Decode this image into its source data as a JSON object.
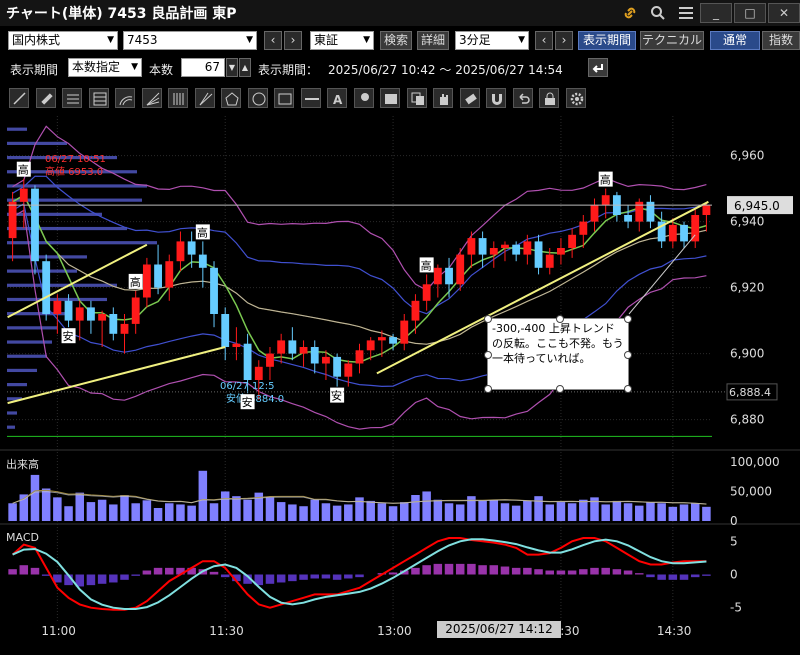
{
  "window": {
    "title": "チャート(単体) 7453 良品計画 東P",
    "buttons": [
      "_",
      "□",
      "✕"
    ]
  },
  "toolbar1": {
    "market_type": "国内株式",
    "symbol": "7453",
    "exchange": "東証",
    "search_label": "検索",
    "detail_label": "詳細",
    "interval": "3分足",
    "display_period_label": "表示期間",
    "technical_label": "テクニカル",
    "normal_label": "通常",
    "index_label": "指数"
  },
  "toolbar2": {
    "period_label": "表示期間",
    "period_mode": "本数指定",
    "count_label": "本数",
    "count_value": "67",
    "period_range_label": "表示期間：",
    "period_range": "2025/06/27 10:42 ～ 2025/06/27 14:54"
  },
  "drawing_tools": [
    "line-tool",
    "ruler-tool",
    "hlines-tool",
    "channel-tool",
    "arc-tool",
    "fan-tool",
    "vlines-tool",
    "speedline-tool",
    "pentagon-tool",
    "circle-tool",
    "rect-tool",
    "hline-tool",
    "text-tool",
    "icon-tool",
    "memo-tool",
    "copy-tool",
    "hand-tool",
    "eraser-tool",
    "magnet-tool",
    "undo-tool",
    "lock-tool",
    "settings-tool"
  ],
  "price_chart": {
    "y_ticks": [
      "6,960",
      "6,940",
      "6,920",
      "6,900",
      "6,880"
    ],
    "current_price_label": "6,945.0",
    "low_line_label": "6,888.4",
    "high_annotation_time": "06/27 10:51",
    "high_annotation_value": "高値 6953.0",
    "low_annotation_time": "06/27 12:5",
    "low_annotation_value": "安値 6884.0",
    "markers_high": [
      "高",
      "高",
      "高",
      "高",
      "高"
    ],
    "markers_low": [
      "安",
      "安",
      "安"
    ],
    "memo_text": "-300,-400 上昇トレンドの反転。ここも不発。もう一本待っていれば。"
  },
  "volume_chart": {
    "label": "出来高",
    "y_ticks": [
      "100,000",
      "50,000",
      "0"
    ]
  },
  "macd_chart": {
    "label": "MACD",
    "y_ticks": [
      "5",
      "0",
      "-5"
    ]
  },
  "time_axis": {
    "labels": [
      "11:00",
      "11:30",
      "13:00",
      "13:30",
      "14:30"
    ],
    "cursor_time": "2025/06/27 14:12"
  },
  "colors": {
    "up_candle": "#ff1a1a",
    "down_candle": "#66ccff",
    "ma_fast": "#7ac850",
    "ma_slow": "#a08a40",
    "bollinger_outer": "#b050b0",
    "bollinger_inner": "#4050d0",
    "trendline": "#f0f080",
    "volume_bar": "#8080ff",
    "macd_line": "#ff0000",
    "signal_line": "#80e0e0"
  },
  "chart_data": {
    "type": "candlestick",
    "price": {
      "ylim": [
        6872,
        6972
      ],
      "candles": [
        [
          6935,
          6949,
          6928,
          6946
        ],
        [
          6946,
          6953,
          6938,
          6950
        ],
        [
          6950,
          6951,
          6924,
          6928
        ],
        [
          6928,
          6930,
          6910,
          6912
        ],
        [
          6912,
          6918,
          6906,
          6916
        ],
        [
          6916,
          6918,
          6908,
          6910
        ],
        [
          6910,
          6916,
          6904,
          6914
        ],
        [
          6914,
          6916,
          6906,
          6910
        ],
        [
          6910,
          6913,
          6902,
          6912
        ],
        [
          6912,
          6914,
          6904,
          6906
        ],
        [
          6906,
          6912,
          6900,
          6909
        ],
        [
          6909,
          6919,
          6906,
          6917
        ],
        [
          6917,
          6929,
          6914,
          6927
        ],
        [
          6927,
          6933,
          6918,
          6920
        ],
        [
          6920,
          6930,
          6916,
          6928
        ],
        [
          6928,
          6937,
          6925,
          6934
        ],
        [
          6934,
          6937,
          6926,
          6930
        ],
        [
          6930,
          6934,
          6920,
          6926
        ],
        [
          6926,
          6928,
          6908,
          6912
        ],
        [
          6912,
          6914,
          6898,
          6902
        ],
        [
          6902,
          6908,
          6898,
          6903
        ],
        [
          6903,
          6906,
          6888,
          6892
        ],
        [
          6892,
          6898,
          6886,
          6896
        ],
        [
          6896,
          6902,
          6892,
          6900
        ],
        [
          6900,
          6906,
          6897,
          6904
        ],
        [
          6904,
          6908,
          6898,
          6900
        ],
        [
          6900,
          6904,
          6896,
          6902
        ],
        [
          6902,
          6904,
          6894,
          6897
        ],
        [
          6897,
          6901,
          6892,
          6899
        ],
        [
          6899,
          6900,
          6890,
          6893
        ],
        [
          6893,
          6898,
          6890,
          6897
        ],
        [
          6897,
          6903,
          6894,
          6901
        ],
        [
          6901,
          6905,
          6898,
          6904
        ],
        [
          6904,
          6907,
          6899,
          6905
        ],
        [
          6905,
          6906,
          6901,
          6903
        ],
        [
          6903,
          6912,
          6901,
          6910
        ],
        [
          6910,
          6918,
          6906,
          6916
        ],
        [
          6916,
          6924,
          6913,
          6921
        ],
        [
          6921,
          6927,
          6917,
          6926
        ],
        [
          6926,
          6929,
          6917,
          6921
        ],
        [
          6921,
          6932,
          6919,
          6930
        ],
        [
          6930,
          6937,
          6926,
          6935
        ],
        [
          6935,
          6937,
          6926,
          6930
        ],
        [
          6930,
          6934,
          6926,
          6932
        ],
        [
          6932,
          6934,
          6928,
          6933
        ],
        [
          6933,
          6934,
          6928,
          6930
        ],
        [
          6930,
          6936,
          6927,
          6934
        ],
        [
          6934,
          6936,
          6924,
          6926
        ],
        [
          6926,
          6932,
          6924,
          6930
        ],
        [
          6930,
          6935,
          6927,
          6932
        ],
        [
          6932,
          6938,
          6929,
          6936
        ],
        [
          6936,
          6942,
          6932,
          6940
        ],
        [
          6940,
          6947,
          6937,
          6945
        ],
        [
          6945,
          6950,
          6941,
          6948
        ],
        [
          6948,
          6949,
          6940,
          6942
        ],
        [
          6942,
          6945,
          6938,
          6940
        ],
        [
          6940,
          6947,
          6937,
          6946
        ],
        [
          6946,
          6948,
          6938,
          6940
        ],
        [
          6940,
          6943,
          6932,
          6934
        ],
        [
          6934,
          6941,
          6932,
          6939
        ],
        [
          6939,
          6940,
          6932,
          6934
        ],
        [
          6934,
          6944,
          6932,
          6942
        ],
        [
          6942,
          6946,
          6937,
          6945
        ]
      ],
      "high_price": 6953.0,
      "low_price": 6884.0,
      "current_price": 6945.0,
      "reference_line": 6888.4
    },
    "volume": {
      "ylim": [
        0,
        110000
      ],
      "values": [
        30000,
        45000,
        78000,
        55000,
        40000,
        25000,
        48000,
        32000,
        36000,
        28000,
        44000,
        30000,
        35000,
        22000,
        30000,
        28000,
        26000,
        85000,
        30000,
        50000,
        42000,
        36000,
        48000,
        40000,
        32000,
        28000,
        25000,
        36000,
        30000,
        26000,
        28000,
        40000,
        34000,
        30000,
        25000,
        32000,
        44000,
        50000,
        36000,
        30000,
        28000,
        42000,
        34000,
        36000,
        30000,
        26000,
        34000,
        42000,
        28000,
        32000,
        30000,
        36000,
        40000,
        28000,
        34000,
        30000,
        26000,
        32000,
        30000,
        24000,
        28000,
        30000,
        24000
      ]
    },
    "macd": {
      "ylim": [
        -7,
        7
      ],
      "histogram": [
        0.8,
        1.4,
        1.0,
        -0.2,
        -1.2,
        -1.6,
        -1.8,
        -1.6,
        -1.4,
        -1.2,
        -0.8,
        -0.2,
        0.6,
        1.0,
        1.0,
        1.0,
        1.0,
        0.8,
        0.4,
        -0.4,
        -1.0,
        -1.4,
        -1.6,
        -1.4,
        -1.2,
        -1.0,
        -0.8,
        -0.6,
        -0.6,
        -0.8,
        -0.6,
        -0.4,
        0.0,
        0.2,
        0.3,
        0.6,
        1.0,
        1.4,
        1.6,
        1.6,
        1.6,
        1.6,
        1.4,
        1.4,
        1.2,
        1.0,
        1.0,
        0.8,
        0.6,
        0.6,
        0.6,
        0.8,
        1.0,
        1.0,
        0.8,
        0.6,
        0.2,
        -0.4,
        -0.8,
        -0.8,
        -0.8,
        -0.4,
        -0.2
      ],
      "macd_line": [
        3,
        4.5,
        4,
        1,
        -2,
        -3.5,
        -4.5,
        -5,
        -5.2,
        -5.3,
        -5.3,
        -5,
        -4,
        -2.5,
        -1,
        0,
        1,
        2,
        2,
        1,
        -1,
        -3,
        -4.5,
        -5,
        -4.5,
        -4,
        -3.5,
        -3,
        -3,
        -3,
        -2.5,
        -2,
        -1,
        0,
        1,
        2,
        3,
        4,
        5,
        5.5,
        5.5,
        5.2,
        5,
        4.8,
        4.5,
        4,
        3,
        3,
        3.2,
        4,
        5,
        5.5,
        5.5,
        5,
        4,
        3,
        2,
        1.5,
        1.5,
        1.8,
        2,
        2,
        2
      ]
    }
  }
}
